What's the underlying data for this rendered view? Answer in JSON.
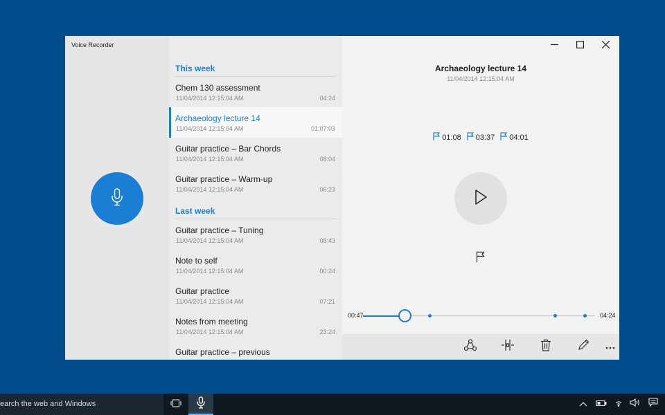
{
  "app": {
    "title": "Voice Recorder"
  },
  "sections": [
    {
      "header": "This week"
    },
    {
      "header": "Last week"
    }
  ],
  "recordings": [
    {
      "name": "Chem 130 assessment",
      "date": "11/04/2014 12:15:04 AM",
      "duration": "04:24"
    },
    {
      "name": "Archaeology lecture 14",
      "date": "11/04/2014 12:15:04 AM",
      "duration": "01:07:03",
      "selected": true
    },
    {
      "name": "Guitar practice – Bar Chords",
      "date": "11/04/2014 12:15:04 AM",
      "duration": "08:04"
    },
    {
      "name": "Guitar practice – Warm-up",
      "date": "11/04/2014 12:15:04 AM",
      "duration": "06:23"
    },
    {
      "name": "Guitar practice – Tuning",
      "date": "11/04/2014 12:15:04 AM",
      "duration": "08:43"
    },
    {
      "name": "Note to self",
      "date": "11/04/2014 12:15:04 AM",
      "duration": "00:24"
    },
    {
      "name": "Guitar practice",
      "date": "11/04/2014 12:15:04 AM",
      "duration": "07:21"
    },
    {
      "name": "Notes from meeting",
      "date": "11/04/2014 12:15:04 AM",
      "duration": "23:24"
    },
    {
      "name": "Guitar practice – previous",
      "date": "",
      "duration": ""
    }
  ],
  "detail": {
    "title": "Archaeology lecture 14",
    "date": "11/04/2014 12:15:04 AM",
    "markers": [
      "01:08",
      "03:37",
      "04:01"
    ],
    "current_time": "00:47",
    "total_time": "04:24",
    "progress": 0.18,
    "marker_positions": [
      0.29,
      0.83,
      0.96
    ]
  },
  "commands": [
    "share-icon",
    "trim-icon",
    "delete-icon",
    "rename-icon",
    "more-icon"
  ],
  "taskbar": {
    "search_text": "earch the web and Windows"
  },
  "colors": {
    "accent": "#1a7fd4",
    "desktop": "#024c8c",
    "taskbar": "#101820"
  }
}
